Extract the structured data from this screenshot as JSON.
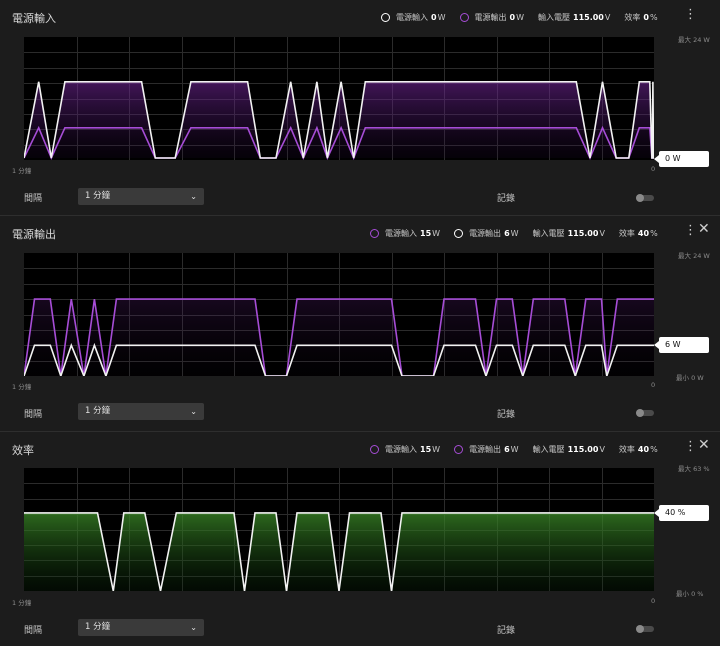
{
  "common": {
    "interval_label": "間隔",
    "interval_value": "1 分鐘",
    "record_label": "記錄",
    "x_start": "1 分鐘",
    "x_end": "0",
    "label_voltage": "輸入電壓",
    "label_eff": "效率",
    "label_in": "電源輸入",
    "label_out": "電源輸出"
  },
  "panels": [
    {
      "title": "電源輸入",
      "legend": {
        "in_value": "0",
        "in_unit": "W",
        "out_value": "0",
        "out_unit": "W",
        "voltage_value": "115.00",
        "voltage_unit": "V",
        "eff_value": "0",
        "eff_unit": "%"
      },
      "ymax_label": "最大 24 W",
      "ymin_label": "",
      "current_value": "0 W",
      "colors": {
        "in_dot": "#ffffff",
        "out_dot": "#a64dd6"
      }
    },
    {
      "title": "電源輸出",
      "legend": {
        "in_value": "15",
        "in_unit": "W",
        "out_value": "6",
        "out_unit": "W",
        "voltage_value": "115.00",
        "voltage_unit": "V",
        "eff_value": "40",
        "eff_unit": "%"
      },
      "ymax_label": "最大 24 W",
      "ymin_label": "最小 0 W",
      "current_value": "6 W",
      "colors": {
        "in_dot": "#a64dd6",
        "out_dot": "#ffffff"
      }
    },
    {
      "title": "效率",
      "legend": {
        "in_value": "15",
        "in_unit": "W",
        "out_value": "6",
        "out_unit": "W",
        "voltage_value": "115.00",
        "voltage_unit": "V",
        "eff_value": "40",
        "eff_unit": "%"
      },
      "ymax_label": "最大 63 %",
      "ymin_label": "最小 0 %",
      "current_value": "40 %",
      "colors": {
        "in_dot": "#a64dd6",
        "out_dot": "#a64dd6"
      }
    }
  ],
  "colors": {
    "purple": "#a64dd6",
    "white": "#f2f2f2",
    "green": "#3b8a28",
    "grid": "#2b2b2b"
  },
  "chart_data": [
    {
      "type": "area",
      "series": [
        {
          "name": "電源輸入",
          "values": [
            0,
            0.63,
            0,
            0.63,
            0.63,
            0.63,
            0.63,
            0,
            0,
            0.63,
            0.63,
            0.63,
            0,
            0,
            0.63,
            0,
            0.63,
            0,
            0.63,
            0,
            0.63,
            0.63,
            0.63,
            0.63,
            0.63,
            0.63,
            0,
            0.63,
            0,
            0,
            0.63,
            0.63,
            0,
            0,
            0.63,
            0,
            0
          ]
        },
        {
          "name": "電源輸出",
          "values": [
            0,
            0.25,
            0,
            0.25,
            0.25,
            0.25,
            0.25,
            0,
            0,
            0.25,
            0.25,
            0.25,
            0,
            0,
            0.25,
            0,
            0.25,
            0,
            0.25,
            0,
            0.25,
            0.25,
            0.25,
            0.25,
            0.25,
            0.25,
            0,
            0.25,
            0,
            0,
            0.25,
            0.25,
            0,
            0,
            0.25,
            0,
            0
          ]
        }
      ],
      "x_time_points": [
        60,
        58.6,
        57.4,
        56.1,
        55,
        50,
        48.8,
        47.5,
        45.6,
        44.1,
        40,
        38.7,
        37.5,
        36,
        34.6,
        33.4,
        32.1,
        31.1,
        29.8,
        28.6,
        27.5,
        20,
        15,
        10,
        8.6,
        7.4,
        6.1,
        4.9,
        3.6,
        2.4,
        1.4,
        0.4,
        0.2,
        0.15,
        0.1,
        0.05,
        0
      ]
    },
    {
      "type": "line",
      "series": [
        {
          "name": "電源輸入",
          "values": [
            0,
            15,
            15,
            0,
            15,
            0,
            15,
            0,
            15,
            15,
            15,
            0,
            0,
            15,
            15,
            0,
            0,
            15,
            15,
            15,
            0,
            15,
            15,
            0,
            15,
            15,
            0,
            15,
            15,
            0,
            15,
            15
          ]
        },
        {
          "name": "電源輸出",
          "values": [
            0,
            6,
            6,
            0,
            6,
            0,
            6,
            0,
            6,
            6,
            6,
            0,
            0,
            6,
            6,
            0,
            0,
            6,
            6,
            6,
            0,
            6,
            6,
            0,
            6,
            6,
            0,
            6,
            6,
            0,
            6,
            6
          ]
        }
      ],
      "ylim": [
        0,
        24
      ],
      "x_time_points": [
        60,
        59,
        57.5,
        56.5,
        55.5,
        54.3,
        53.3,
        52.2,
        51.2,
        42,
        38,
        37,
        35,
        34,
        25,
        24,
        21,
        20,
        18,
        17,
        16,
        15,
        13.5,
        12.5,
        11.5,
        8.5,
        7.5,
        6.5,
        5,
        4.5,
        3.5,
        0
      ]
    },
    {
      "type": "area",
      "series": [
        {
          "name": "效率",
          "values": [
            40,
            40,
            40,
            0,
            40,
            40,
            0,
            40,
            40,
            40,
            0,
            40,
            40,
            0,
            40,
            40,
            0,
            40,
            40,
            0,
            40,
            40,
            40
          ]
        }
      ],
      "ylim": [
        0,
        63
      ],
      "x_time_points": [
        60,
        55,
        53,
        51.5,
        50.5,
        48.5,
        47,
        45.5,
        42,
        40,
        39,
        38,
        36,
        35,
        34,
        31,
        30,
        29,
        26,
        25,
        24,
        20,
        0
      ]
    }
  ]
}
